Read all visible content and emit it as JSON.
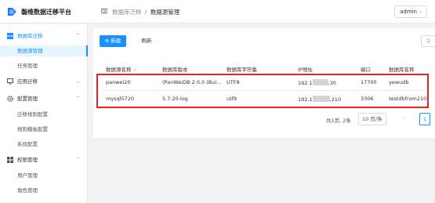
{
  "app": {
    "title": "磐维数据迁移平台"
  },
  "header": {
    "breadcrumb_parent": "数据库迁移",
    "breadcrumb_separator": "/",
    "breadcrumb_current": "数据源管理",
    "user": "admin"
  },
  "sidebar": {
    "groups": [
      {
        "label": "数据库迁移",
        "icon": "database-icon",
        "expanded": true,
        "items": [
          {
            "label": "数据源管理",
            "selected": true
          },
          {
            "label": "任务管理"
          }
        ]
      },
      {
        "label": "应用迁移",
        "icon": "monitor-icon",
        "expanded": false,
        "items": []
      },
      {
        "label": "配置管理",
        "icon": "gear-icon",
        "expanded": true,
        "items": [
          {
            "label": "迁移规则配置"
          },
          {
            "label": "规则模板配置"
          },
          {
            "label": "系统配置"
          }
        ]
      },
      {
        "label": "权限管理",
        "icon": "grid-icon",
        "expanded": true,
        "items": [
          {
            "label": "用户管理"
          },
          {
            "label": "角色管理"
          }
        ]
      }
    ]
  },
  "toolbar": {
    "new_label": "新建",
    "refresh_label": "刷新"
  },
  "table": {
    "columns": [
      "数据源名称",
      "数据库版本",
      "数据库字符集",
      "IP地址",
      "端口",
      "数据库名称"
    ],
    "rows": [
      {
        "name": "panwei20",
        "version": "(PanWeiDB 2.0.0 (Bui...",
        "charset": "UTF8",
        "ip_prefix": "192.1",
        "ip_suffix": ".30",
        "port": "17700",
        "db": "yewudb"
      },
      {
        "name": "mysql5720",
        "version": "5.7.20-log",
        "charset": "utf8",
        "ip_prefix": "192.1",
        "ip_suffix": ".210",
        "port": "3306",
        "db": "testdbfrom210"
      }
    ]
  },
  "pagination": {
    "total_text": "共1页, 2条",
    "page_size": "10 页/条",
    "current_page": "1"
  },
  "colors": {
    "accent": "#1890ff",
    "highlight_border": "#e12525"
  }
}
